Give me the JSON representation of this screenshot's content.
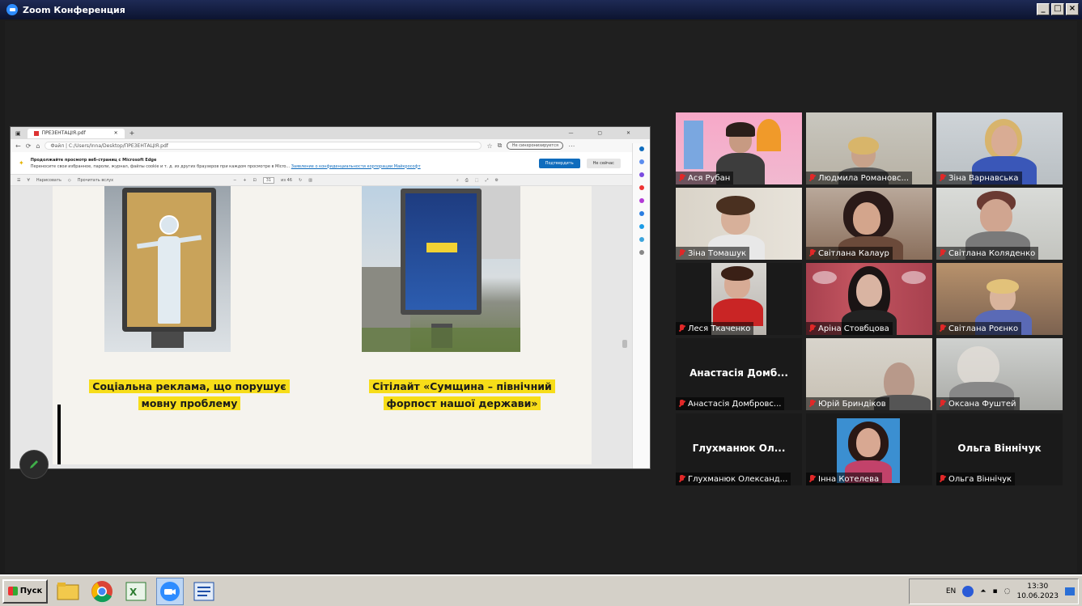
{
  "window": {
    "title": "Zoom Конференция",
    "controls": [
      "_",
      "□",
      "×"
    ]
  },
  "share": {
    "tab_title": "ПРЕЗЕНТАЦІЯ.pdf",
    "url": "Файл | C:/Users/Inna/Desktop/ПРЕЗЕНТАЦІЯ.pdf",
    "ext_label": "Не синхронизируется",
    "info_title": "Продолжайте просмотр веб-страниц с Microsoft Edge",
    "info_text": "Переносите свои избранное, пароли, журнал, файлы cookie и т. д. из других браузеров при каждом просмотре в Micro...",
    "info_link": "Заявление о конфиденциальности корпорации Майкрософт",
    "info_btn_primary": "Подтвердить",
    "info_btn_secondary": "Не сейчас",
    "pdf_toolbar_draw": "Нарисовать",
    "pdf_toolbar_read": "Прочитать вслух",
    "page_of": "из 46",
    "caption_left": "Соціальна реклама, що порушує мовну проблему",
    "caption_right": "Сітілайт «Сумщина – північний форпост нашої держави»"
  },
  "participants": [
    {
      "name": "Ася Рубан",
      "video": true
    },
    {
      "name": "Людмила Романовс...",
      "video": true
    },
    {
      "name": "Зіна Варнавська",
      "video": true
    },
    {
      "name": "Зіна Томашук",
      "video": true
    },
    {
      "name": "Світлана Калаур",
      "video": true
    },
    {
      "name": "Світлана Коляденко",
      "video": true
    },
    {
      "name": "Леся Ткаченко",
      "video": true
    },
    {
      "name": "Аріна Стовбцова",
      "video": true,
      "active": true
    },
    {
      "name": "Світлана Роєнко",
      "video": true
    },
    {
      "name": "Анастасія Домбровс...",
      "display": "Анастасія Домб...",
      "video": false
    },
    {
      "name": "Юрій Бриндіков",
      "video": true
    },
    {
      "name": "Оксана Фуштей",
      "video": true
    },
    {
      "name": "Глухманюк Олександ...",
      "display": "Глухманюк Ол...",
      "video": false
    },
    {
      "name": "Інна Котелева",
      "video": true
    },
    {
      "name": "Ольга Віннічук",
      "display": "Ольга Віннічук",
      "video": false
    }
  ],
  "taskbar": {
    "start_label": "Пуск",
    "apps": [
      "explorer-icon",
      "chrome-icon",
      "excel-icon",
      "zoom-icon",
      "word-icon"
    ],
    "lang": "EN",
    "time": "13:30",
    "date": "10.06.2023"
  },
  "colors": {
    "caption_highlight": "#f7dd19",
    "active_speaker": "#c9e25a",
    "muted_mic": "#e02828"
  }
}
